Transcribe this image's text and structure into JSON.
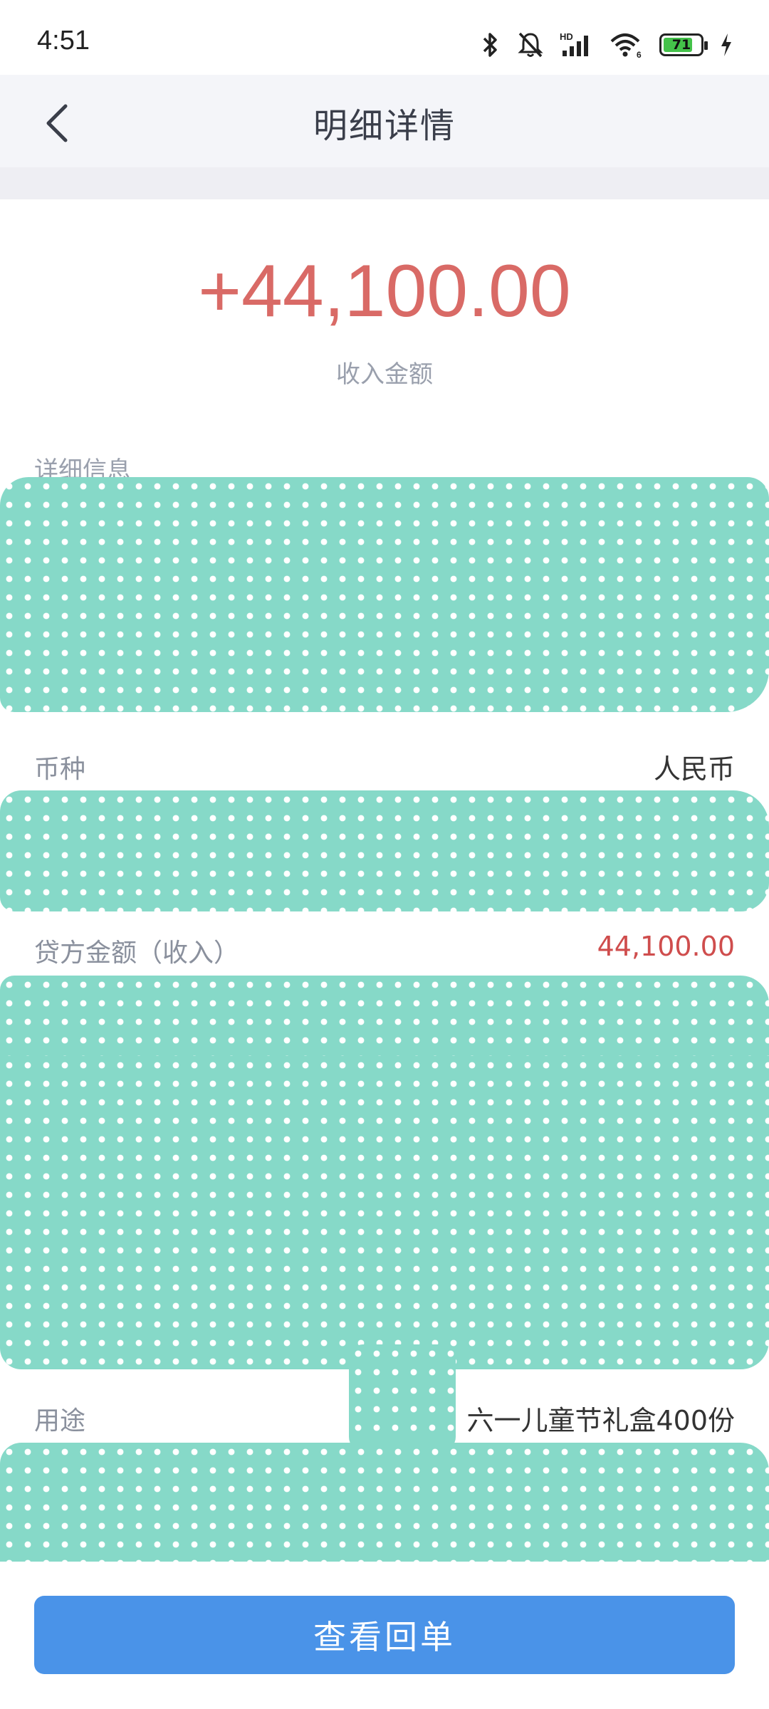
{
  "status_bar": {
    "time": "4:51",
    "battery_level": "71",
    "icons": [
      "bluetooth-icon",
      "mute-bell-icon",
      "hd-signal-icon",
      "wifi-icon",
      "battery-icon",
      "charging-icon"
    ]
  },
  "header": {
    "title": "明细详情",
    "back_icon": "chevron-left-icon"
  },
  "amount": {
    "value": "+44,100.00",
    "label": "收入金额",
    "color": "#d96a66"
  },
  "details": {
    "section_title": "详细信息",
    "rows": [
      {
        "label": "币种",
        "value": "人民币"
      },
      {
        "label": "贷方金额（收入）",
        "value": "44,100.00"
      },
      {
        "label": "用途",
        "value": "六一儿童节礼盒400份"
      }
    ]
  },
  "bottom": {
    "button_label": "查看回单",
    "button_color": "#4a93e8"
  }
}
